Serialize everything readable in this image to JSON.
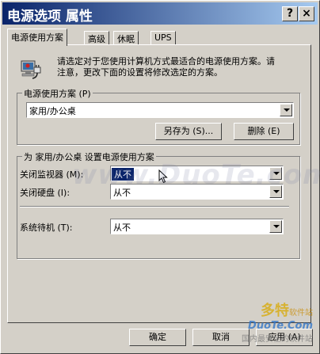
{
  "window": {
    "title": "电源选项 属性",
    "help_btn": "?",
    "close_btn": "×"
  },
  "tabs": [
    "电源使用方案",
    "高级",
    "休眠",
    "UPS"
  ],
  "intro_text_1": "请选定对于您使用计算机方式最适合的电源使用方案。请",
  "intro_text_2": "注意，更改下面的设置将修改选定的方案。",
  "scheme_group": {
    "label": "电源使用方案 (P)",
    "selected": "家用/办公桌",
    "save_as": "另存为 (S)...",
    "delete": "删除 (E)"
  },
  "settings_group": {
    "label": "为 家用/办公桌 设置电源使用方案",
    "monitor_label": "关闭监视器 (M):",
    "monitor_value": "从不",
    "disk_label": "关闭硬盘 (I):",
    "disk_value": "从不",
    "standby_label": "系统待机 (T):",
    "standby_value": "从不"
  },
  "footer": {
    "ok": "确定",
    "cancel": "取消",
    "apply": "应用 (A)"
  },
  "watermark": {
    "center": "www.DuoTe.com",
    "brand": "多特",
    "brand_sub": "软件站",
    "site": "DuoTe.Com",
    "tagline": "国内最安全的软件站"
  },
  "colors": {
    "titlebar_start": "#0a246a",
    "titlebar_end": "#a6caf0",
    "face": "#d4d0c8",
    "selection": "#0a246a"
  },
  "icons": [
    "power-options-icon",
    "chevron-down-icon",
    "help-icon",
    "close-icon",
    "mouse-cursor-icon"
  ]
}
